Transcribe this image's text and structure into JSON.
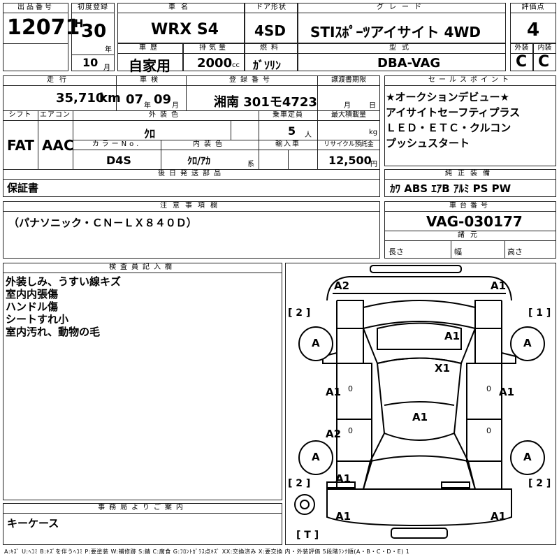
{
  "header": {
    "lot_no_label": "出品番号",
    "lot_no": "12071",
    "first_reg_label": "初度登録",
    "era": "H",
    "year": "30",
    "year_unit": "年",
    "month": "10",
    "month_unit": "月",
    "car_name_label": "車名",
    "car_name": "WRX S4",
    "door_label": "ドア形状",
    "door": "4SD",
    "grade_label": "グレード",
    "grade": "STIｽﾎﾟｰﾂアイサイト 4WD",
    "score_label": "評価点",
    "score": "4",
    "history_label": "車歴",
    "history": "自家用",
    "displacement_label": "排気量",
    "displacement": "2000",
    "displacement_unit": "cc",
    "fuel_label": "燃料",
    "fuel": "ｶﾞｿﾘﾝ",
    "model_label": "型式",
    "model": "DBA-VAG",
    "ext_label": "外装",
    "ext_grade": "C",
    "int_label": "内装",
    "int_grade": "C"
  },
  "vehicle": {
    "mileage_label": "走行",
    "mileage": "35,710",
    "mileage_unit": "km",
    "inspection_label": "車検",
    "insp_year": "07",
    "insp_year_unit": "年",
    "insp_month": "09",
    "insp_month_unit": "月",
    "plate_label": "登録番号",
    "plate": "湘南 301モ4723",
    "transfer_label": "譲渡書期限",
    "transfer_month_unit": "月",
    "transfer_day_unit": "日",
    "shift_label": "シフト",
    "shift": "FAT",
    "ac_label": "エアコン",
    "ac": "AAC",
    "exterior_color_label": "外装色",
    "exterior_color": "ｸﾛ",
    "capacity_label": "乗車定員",
    "capacity": "5",
    "capacity_unit": "人",
    "max_load_label": "最大積載量",
    "max_load_unit": "kg",
    "color_no_label": "カラーNo.",
    "color_no": "D4S",
    "interior_color_label": "内装色",
    "interior_color": "ｸﾛ/ｱｶ",
    "interior_color_suffix": "系",
    "import_label": "輸入車",
    "recycle_label": "リサイクル預託金",
    "recycle": "12,500",
    "recycle_unit": "円",
    "later_parts_label": "後日発送部品",
    "later_parts": "保証書"
  },
  "sales_points": {
    "label": "セールスポイント",
    "lines": [
      "★オークションデビュー★",
      "アイサイトセーフティプラス",
      "ＬＥＤ・ＥＴＣ・クルコン",
      "プッシュスタート"
    ]
  },
  "equipment": {
    "label": "純正装備",
    "items": "ｶﾜ ABS ｴｱB ｱﾙﾐ PS PW"
  },
  "notes": {
    "label": "注意事項欄",
    "text": "（パナソニック・ＣＮ－ＬＸ８４０Ｄ）"
  },
  "chassis": {
    "label": "車台番号",
    "number": "VAG-030177",
    "specs_label": "諸元",
    "length_label": "長さ",
    "width_label": "幅",
    "height_label": "高さ"
  },
  "inspector": {
    "label": "検査員記入欄",
    "lines": [
      "外装しみ、うすい線キズ",
      "室内内張傷",
      "ハンドル傷",
      "シートすれ小",
      "室内汚れ、動物の毛"
    ]
  },
  "office": {
    "label": "事務局よりご案内",
    "text": "キーケース"
  },
  "diagram": {
    "corner_fr": "[ 1 ]",
    "corner_fl": "[ 2 ]",
    "corner_rl": "[ 2 ]",
    "corner_rr": "[ 2 ]",
    "corner_t": "[ T ]",
    "marks": {
      "front_bumper_left": "A2",
      "front_bumper_right": "A1",
      "hood": "A1",
      "windshield": "X1",
      "left_door_front": "A1",
      "right_door_front": "A1",
      "left_door_rear": "A2",
      "roof": "A1",
      "left_rear_fender": "A1",
      "rear_bumper_left": "A1",
      "rear_bumper_right": "A1",
      "wheel_fr": "A",
      "wheel_fl": "A",
      "wheel_rl": "A",
      "wheel_rr": "A",
      "door_tick": "0"
    }
  },
  "legend": "A:ｷｽﾞ U:ﾍｺﾐ B:ｷｽﾞを伴うﾍｺﾐ P:要塗装 W:補修跡 S:錆 C:腐食 G:ﾌﾛﾝﾄｶﾞﾗｽ点ｷｽﾞ XX:交換済み X:要交換 内・外装評価 5段階ﾗﾝｸ順(A・B・C・D・E) 1"
}
